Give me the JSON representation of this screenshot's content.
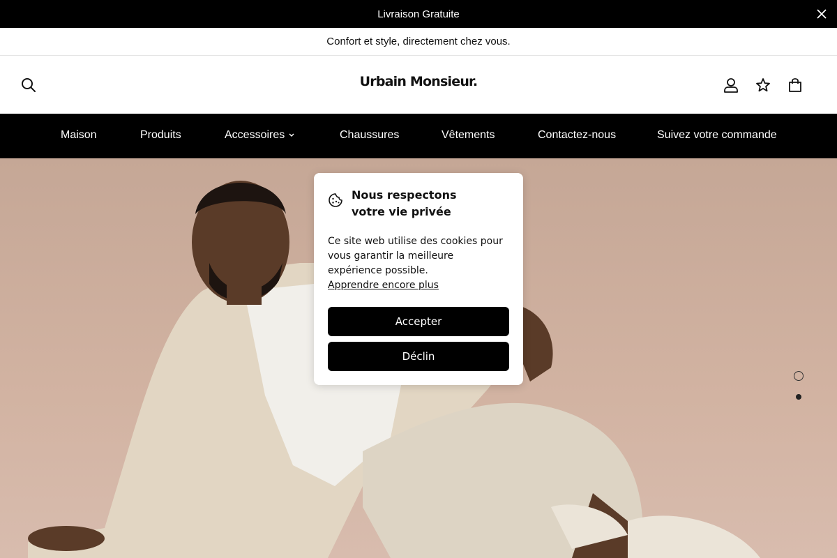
{
  "announcement": {
    "text": "Livraison Gratuite",
    "close_icon": "close-icon"
  },
  "subbar": {
    "text": "Confort et style, directement chez vous."
  },
  "header": {
    "logo": "Urbain Monsieur.",
    "icons": [
      "search-icon",
      "account-icon",
      "star-icon",
      "bag-icon"
    ]
  },
  "nav": {
    "items": [
      {
        "label": "Maison"
      },
      {
        "label": "Produits"
      },
      {
        "label": "Accessoires"
      },
      {
        "label": "Chaussures"
      },
      {
        "label": "Vêtements"
      },
      {
        "label": "Contactez-nous"
      },
      {
        "label": "Suivez votre commande"
      }
    ]
  },
  "cookie": {
    "title_line1": "Nous respectons",
    "title_line2": "votre vie privée",
    "body": "Ce site web utilise des cookies pour vous garantir la meilleure expérience possible.",
    "learn_more": "Apprendre encore plus",
    "accept": "Accepter",
    "decline": "Déclin"
  },
  "hero": {
    "slides_count": 2,
    "active_slide": 2
  },
  "colors": {
    "primary": "#000000",
    "background": "#ffffff",
    "hero_background": "#d2b3a2"
  }
}
